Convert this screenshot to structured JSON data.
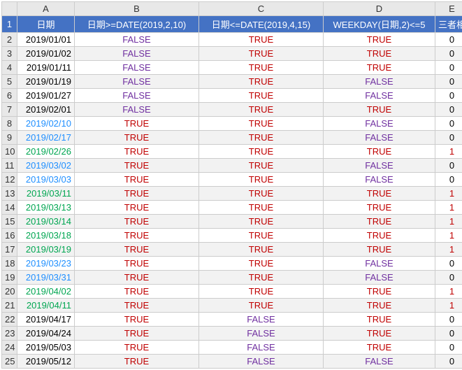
{
  "columns": [
    "A",
    "B",
    "C",
    "D",
    "E"
  ],
  "headerRow": {
    "A": "日期",
    "B": "日期>=DATE(2019,2,10)",
    "C": "日期<=DATE(2019,4,15)",
    "D": "WEEKDAY(日期,2)<=5",
    "E": "三者相乘"
  },
  "labels": {
    "true": "TRUE",
    "false": "FALSE"
  },
  "rows": [
    {
      "n": 1
    },
    {
      "n": 2,
      "date": "2019/01/01",
      "dcolor": "blk",
      "b": "FALSE",
      "c": "TRUE",
      "d": "TRUE",
      "e": "0"
    },
    {
      "n": 3,
      "date": "2019/01/02",
      "dcolor": "blk",
      "b": "FALSE",
      "c": "TRUE",
      "d": "TRUE",
      "e": "0"
    },
    {
      "n": 4,
      "date": "2019/01/11",
      "dcolor": "blk",
      "b": "FALSE",
      "c": "TRUE",
      "d": "TRUE",
      "e": "0"
    },
    {
      "n": 5,
      "date": "2019/01/19",
      "dcolor": "blk",
      "b": "FALSE",
      "c": "TRUE",
      "d": "FALSE",
      "e": "0"
    },
    {
      "n": 6,
      "date": "2019/01/27",
      "dcolor": "blk",
      "b": "FALSE",
      "c": "TRUE",
      "d": "FALSE",
      "e": "0"
    },
    {
      "n": 7,
      "date": "2019/02/01",
      "dcolor": "blk",
      "b": "FALSE",
      "c": "TRUE",
      "d": "TRUE",
      "e": "0"
    },
    {
      "n": 8,
      "date": "2019/02/10",
      "dcolor": "blue",
      "b": "TRUE",
      "c": "TRUE",
      "d": "FALSE",
      "e": "0"
    },
    {
      "n": 9,
      "date": "2019/02/17",
      "dcolor": "blue",
      "b": "TRUE",
      "c": "TRUE",
      "d": "FALSE",
      "e": "0"
    },
    {
      "n": 10,
      "date": "2019/02/26",
      "dcolor": "green",
      "b": "TRUE",
      "c": "TRUE",
      "d": "TRUE",
      "e": "1"
    },
    {
      "n": 11,
      "date": "2019/03/02",
      "dcolor": "blue",
      "b": "TRUE",
      "c": "TRUE",
      "d": "FALSE",
      "e": "0"
    },
    {
      "n": 12,
      "date": "2019/03/03",
      "dcolor": "blue",
      "b": "TRUE",
      "c": "TRUE",
      "d": "FALSE",
      "e": "0"
    },
    {
      "n": 13,
      "date": "2019/03/11",
      "dcolor": "green",
      "b": "TRUE",
      "c": "TRUE",
      "d": "TRUE",
      "e": "1"
    },
    {
      "n": 14,
      "date": "2019/03/13",
      "dcolor": "green",
      "b": "TRUE",
      "c": "TRUE",
      "d": "TRUE",
      "e": "1"
    },
    {
      "n": 15,
      "date": "2019/03/14",
      "dcolor": "green",
      "b": "TRUE",
      "c": "TRUE",
      "d": "TRUE",
      "e": "1"
    },
    {
      "n": 16,
      "date": "2019/03/18",
      "dcolor": "green",
      "b": "TRUE",
      "c": "TRUE",
      "d": "TRUE",
      "e": "1"
    },
    {
      "n": 17,
      "date": "2019/03/19",
      "dcolor": "green",
      "b": "TRUE",
      "c": "TRUE",
      "d": "TRUE",
      "e": "1"
    },
    {
      "n": 18,
      "date": "2019/03/23",
      "dcolor": "blue",
      "b": "TRUE",
      "c": "TRUE",
      "d": "FALSE",
      "e": "0"
    },
    {
      "n": 19,
      "date": "2019/03/31",
      "dcolor": "blue",
      "b": "TRUE",
      "c": "TRUE",
      "d": "FALSE",
      "e": "0"
    },
    {
      "n": 20,
      "date": "2019/04/02",
      "dcolor": "green",
      "b": "TRUE",
      "c": "TRUE",
      "d": "TRUE",
      "e": "1"
    },
    {
      "n": 21,
      "date": "2019/04/11",
      "dcolor": "green",
      "b": "TRUE",
      "c": "TRUE",
      "d": "TRUE",
      "e": "1"
    },
    {
      "n": 22,
      "date": "2019/04/17",
      "dcolor": "blk",
      "b": "TRUE",
      "c": "FALSE",
      "d": "TRUE",
      "e": "0"
    },
    {
      "n": 23,
      "date": "2019/04/24",
      "dcolor": "blk",
      "b": "TRUE",
      "c": "FALSE",
      "d": "TRUE",
      "e": "0"
    },
    {
      "n": 24,
      "date": "2019/05/03",
      "dcolor": "blk",
      "b": "TRUE",
      "c": "FALSE",
      "d": "TRUE",
      "e": "0"
    },
    {
      "n": 25,
      "date": "2019/05/12",
      "dcolor": "blk",
      "b": "TRUE",
      "c": "FALSE",
      "d": "FALSE",
      "e": "0"
    }
  ],
  "chart_data": {
    "type": "table",
    "title": "",
    "columns": [
      "日期",
      "日期>=DATE(2019,2,10)",
      "日期<=DATE(2019,4,15)",
      "WEEKDAY(日期,2)<=5",
      "三者相乘"
    ],
    "data": [
      [
        "2019/01/01",
        "FALSE",
        "TRUE",
        "TRUE",
        0
      ],
      [
        "2019/01/02",
        "FALSE",
        "TRUE",
        "TRUE",
        0
      ],
      [
        "2019/01/11",
        "FALSE",
        "TRUE",
        "TRUE",
        0
      ],
      [
        "2019/01/19",
        "FALSE",
        "TRUE",
        "FALSE",
        0
      ],
      [
        "2019/01/27",
        "FALSE",
        "TRUE",
        "FALSE",
        0
      ],
      [
        "2019/02/01",
        "FALSE",
        "TRUE",
        "TRUE",
        0
      ],
      [
        "2019/02/10",
        "TRUE",
        "TRUE",
        "FALSE",
        0
      ],
      [
        "2019/02/17",
        "TRUE",
        "TRUE",
        "FALSE",
        0
      ],
      [
        "2019/02/26",
        "TRUE",
        "TRUE",
        "TRUE",
        1
      ],
      [
        "2019/03/02",
        "TRUE",
        "TRUE",
        "FALSE",
        0
      ],
      [
        "2019/03/03",
        "TRUE",
        "TRUE",
        "FALSE",
        0
      ],
      [
        "2019/03/11",
        "TRUE",
        "TRUE",
        "TRUE",
        1
      ],
      [
        "2019/03/13",
        "TRUE",
        "TRUE",
        "TRUE",
        1
      ],
      [
        "2019/03/14",
        "TRUE",
        "TRUE",
        "TRUE",
        1
      ],
      [
        "2019/03/18",
        "TRUE",
        "TRUE",
        "TRUE",
        1
      ],
      [
        "2019/03/19",
        "TRUE",
        "TRUE",
        "TRUE",
        1
      ],
      [
        "2019/03/23",
        "TRUE",
        "TRUE",
        "FALSE",
        0
      ],
      [
        "2019/03/31",
        "TRUE",
        "TRUE",
        "FALSE",
        0
      ],
      [
        "2019/04/02",
        "TRUE",
        "TRUE",
        "TRUE",
        1
      ],
      [
        "2019/04/11",
        "TRUE",
        "TRUE",
        "TRUE",
        1
      ],
      [
        "2019/04/17",
        "TRUE",
        "FALSE",
        "TRUE",
        0
      ],
      [
        "2019/04/24",
        "TRUE",
        "FALSE",
        "TRUE",
        0
      ],
      [
        "2019/05/03",
        "TRUE",
        "FALSE",
        "TRUE",
        0
      ],
      [
        "2019/05/12",
        "TRUE",
        "FALSE",
        "FALSE",
        0
      ]
    ]
  }
}
